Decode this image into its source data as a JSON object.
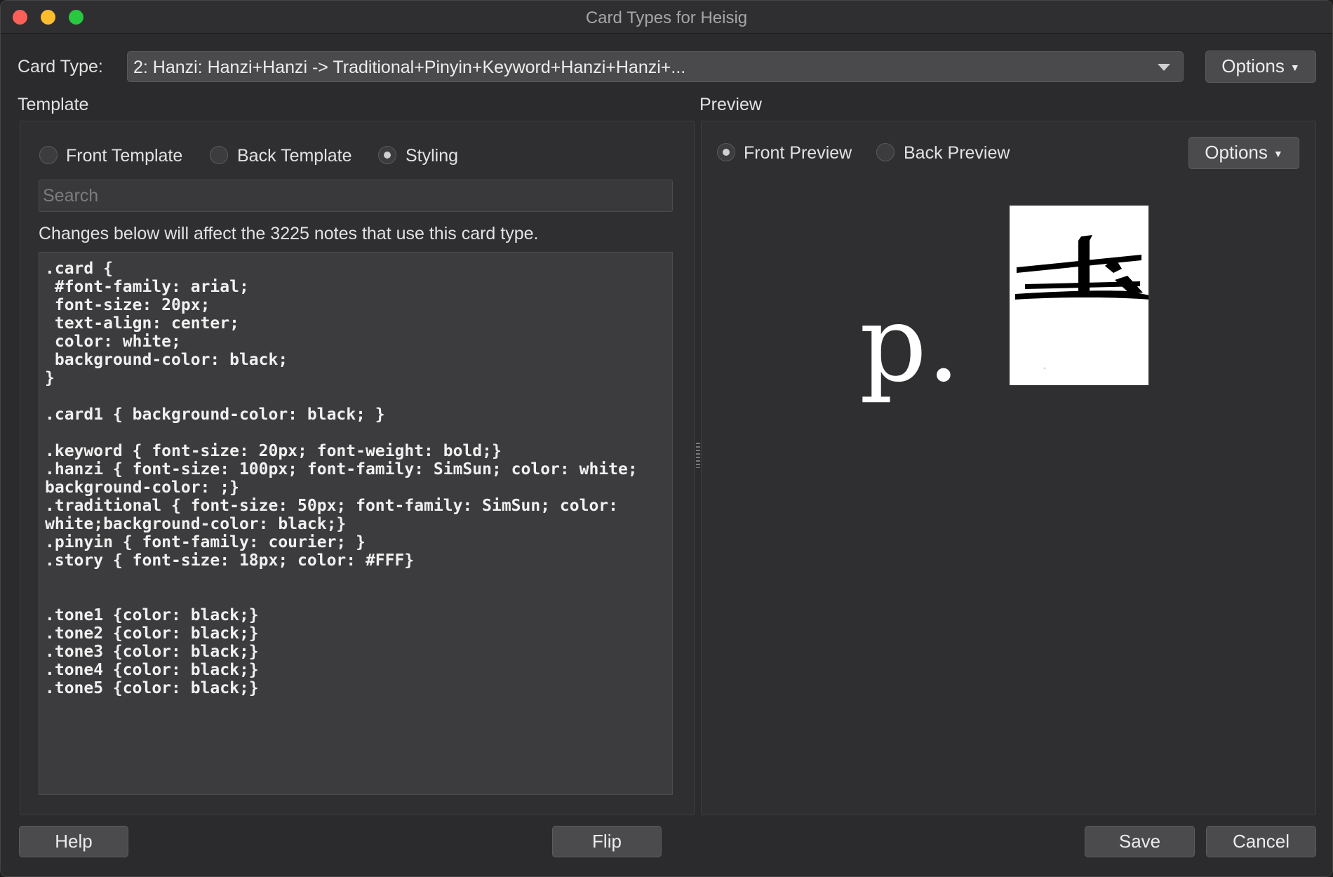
{
  "window": {
    "title": "Card Types for Heisig"
  },
  "card_type": {
    "label": "Card Type:",
    "value": "2: Hanzi: Hanzi+Hanzi -> Traditional+Pinyin+Keyword+Hanzi+Hanzi+...",
    "options_label": "Options"
  },
  "template": {
    "heading": "Template",
    "radios": [
      {
        "label": "Front Template",
        "selected": false
      },
      {
        "label": "Back Template",
        "selected": false
      },
      {
        "label": "Styling",
        "selected": true
      }
    ],
    "search_placeholder": "Search",
    "notice": "Changes below will affect the 3225 notes that use this card type.",
    "css": ".card {\n #font-family: arial;\n font-size: 20px;\n text-align: center;\n color: white;\n background-color: black;\n}\n\n.card1 { background-color: black; }\n\n.keyword { font-size: 20px; font-weight: bold;}\n.hanzi { font-size: 100px; font-family: SimSun; color: white; background-color: ;}\n.traditional { font-size: 50px; font-family: SimSun; color: white;background-color: black;}\n.pinyin { font-family: courier; }\n.story { font-size: 18px; color: #FFF}\n\n\n.tone1 {color: black;}\n.tone2 {color: black;}\n.tone3 {color: black;}\n.tone4 {color: black;}\n.tone5 {color: black;}"
  },
  "preview": {
    "heading": "Preview",
    "radios": [
      {
        "label": "Front Preview",
        "selected": true
      },
      {
        "label": "Back Preview",
        "selected": false
      }
    ],
    "options_label": "Options",
    "card_text": "p."
  },
  "footer": {
    "help": "Help",
    "flip": "Flip",
    "save": "Save",
    "cancel": "Cancel"
  },
  "colors": {
    "window_bg": "#2b2b2d",
    "button_bg": "#4b4b4d",
    "close": "#fe5f57",
    "minimize": "#febc2e",
    "maximize": "#28c840"
  }
}
